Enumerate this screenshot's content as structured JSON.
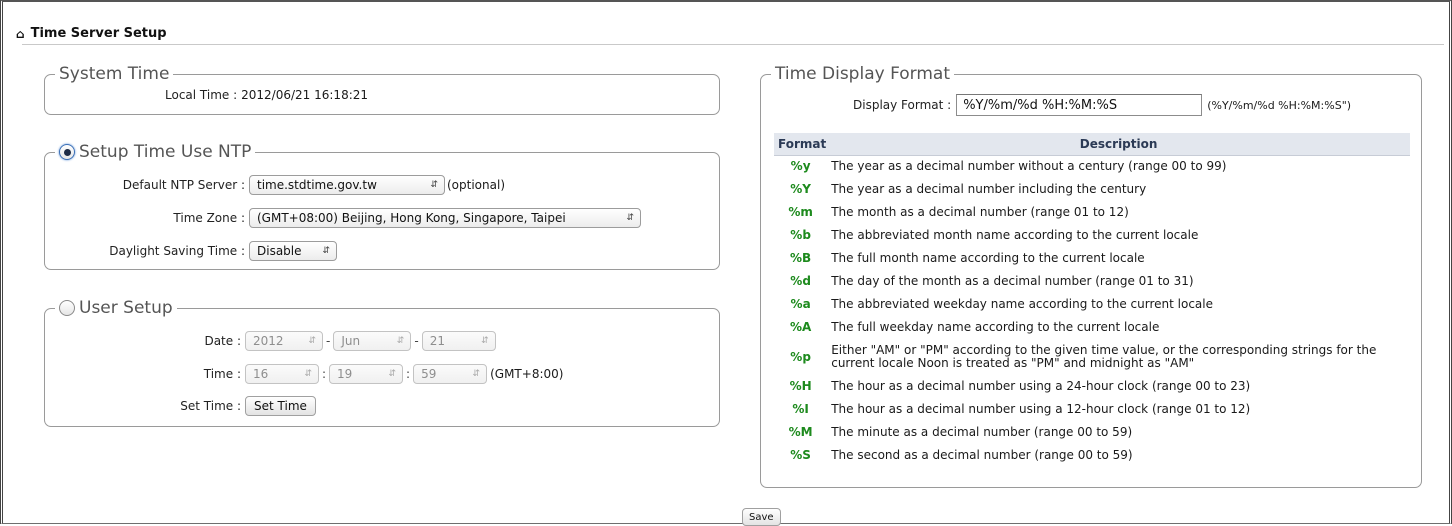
{
  "page": {
    "title": "Time Server Setup",
    "icon": "home-icon"
  },
  "system_time": {
    "legend": "System Time",
    "local_time_label": "Local Time :",
    "local_time_value": "2012/06/21 16:18:21"
  },
  "ntp": {
    "legend": "Setup Time Use NTP",
    "selected": true,
    "server_label": "Default NTP Server :",
    "server_value": "time.stdtime.gov.tw",
    "server_hint": "(optional)",
    "timezone_label": "Time Zone :",
    "timezone_value": "(GMT+08:00) Beijing, Hong Kong, Singapore, Taipei",
    "dst_label": "Daylight Saving Time :",
    "dst_value": "Disable"
  },
  "user_setup": {
    "legend": "User Setup",
    "selected": false,
    "date_label": "Date :",
    "year": "2012",
    "month": "Jun",
    "day": "21",
    "date_sep": "-",
    "time_label": "Time :",
    "hour": "16",
    "minute": "19",
    "second": "59",
    "time_sep": ":",
    "tz_note": "(GMT+8:00)",
    "set_time_label": "Set Time :",
    "set_time_button": "Set Time"
  },
  "display_format": {
    "legend": "Time Display Format",
    "label": "Display Format :",
    "value": "%Y/%m/%d %H:%M:%S",
    "hint": "(%Y/%m/%d %H:%M:%S\")",
    "table_headers": [
      "Format",
      "Description"
    ],
    "rows": [
      {
        "code": "%y",
        "desc": "The year as a decimal number without a century (range 00 to 99)"
      },
      {
        "code": "%Y",
        "desc": "The year as a decimal number including the century"
      },
      {
        "code": "%m",
        "desc": "The month as a decimal number (range 01 to 12)"
      },
      {
        "code": "%b",
        "desc": "The abbreviated month name according to the current locale"
      },
      {
        "code": "%B",
        "desc": "The full month name according to the current locale"
      },
      {
        "code": "%d",
        "desc": "The day of the month as a decimal number (range 01 to 31)"
      },
      {
        "code": "%a",
        "desc": "The abbreviated weekday name according to the current locale"
      },
      {
        "code": "%A",
        "desc": "The full weekday name according to the current locale"
      },
      {
        "code": "%p",
        "desc": "Either \"AM\" or \"PM\" according to the given time value, or the corresponding strings for the current locale Noon is treated as \"PM\" and midnight as \"AM\""
      },
      {
        "code": "%H",
        "desc": "The hour as a decimal number using a 24-hour clock (range 00 to 23)"
      },
      {
        "code": "%I",
        "desc": "The hour as a decimal number using a 12-hour clock (range 01 to 12)"
      },
      {
        "code": "%M",
        "desc": "The minute as a decimal number (range 00 to 59)"
      },
      {
        "code": "%S",
        "desc": "The second as a decimal number (range 00 to 59)"
      }
    ]
  },
  "save_button": "Save",
  "colors": {
    "format_code": "#1d8a1d",
    "table_header_bg": "#e3e7ee",
    "radio_focus": "#3b6fb6"
  }
}
